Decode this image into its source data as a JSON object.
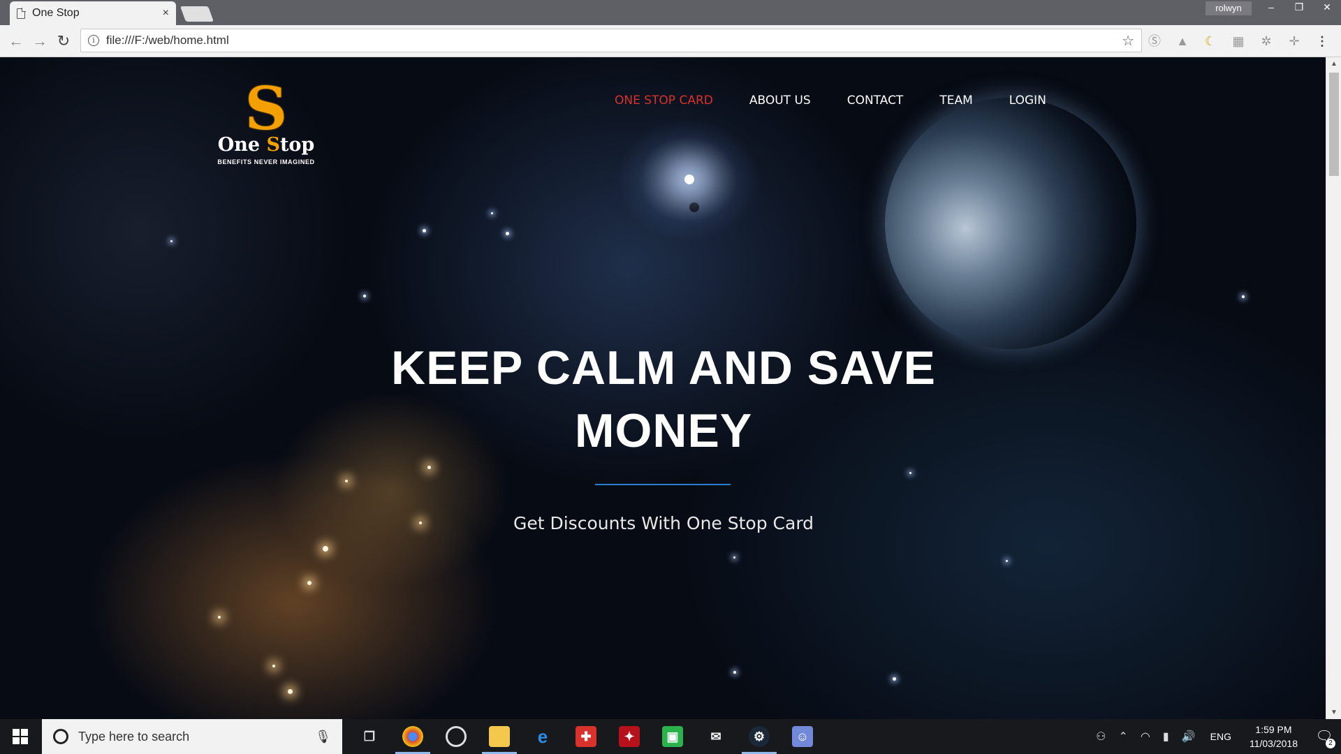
{
  "browser": {
    "tab_title": "One Stop",
    "tab_close": "×",
    "url": "file:///F:/web/home.html",
    "user_name": "rolwyn",
    "window_controls": {
      "minimize": "–",
      "restore": "❐",
      "close": "✕"
    }
  },
  "toolbar_icons": [
    "back-icon",
    "forward-icon",
    "reload-icon",
    "info-icon",
    "star-icon",
    "skype-icon",
    "drive-icon",
    "moon-icon",
    "extension-icon",
    "settings-icon",
    "move-icon",
    "menu-icon"
  ],
  "site": {
    "logo": {
      "mark": "S",
      "brand_prefix": "One ",
      "brand_s": "S",
      "brand_suffix": "top",
      "tagline": "BENEFITS NEVER IMAGINED"
    },
    "nav": [
      {
        "label": "ONE STOP CARD",
        "active": true
      },
      {
        "label": "ABOUT US",
        "active": false
      },
      {
        "label": "CONTACT",
        "active": false
      },
      {
        "label": "TEAM",
        "active": false
      },
      {
        "label": "LOGIN",
        "active": false
      }
    ],
    "hero": {
      "title_line1": "KEEP CALM AND SAVE",
      "title_line2": "MONEY",
      "subtitle": "Get Discounts With One Stop Card"
    },
    "colors": {
      "accent": "#d9322c",
      "logo": "#f4a100",
      "rule": "#2a7ecf"
    }
  },
  "taskbar": {
    "search_placeholder": "Type here to search",
    "apps": [
      "chrome-icon",
      "overwatch-icon",
      "file-explorer-icon",
      "edge-icon",
      "gift-icon",
      "app-red-icon",
      "app-green-icon",
      "mail-icon",
      "steam-icon",
      "discord-icon"
    ],
    "language": "ENG",
    "time": "1:59 PM",
    "date": "11/03/2018",
    "notification_count": "2"
  }
}
